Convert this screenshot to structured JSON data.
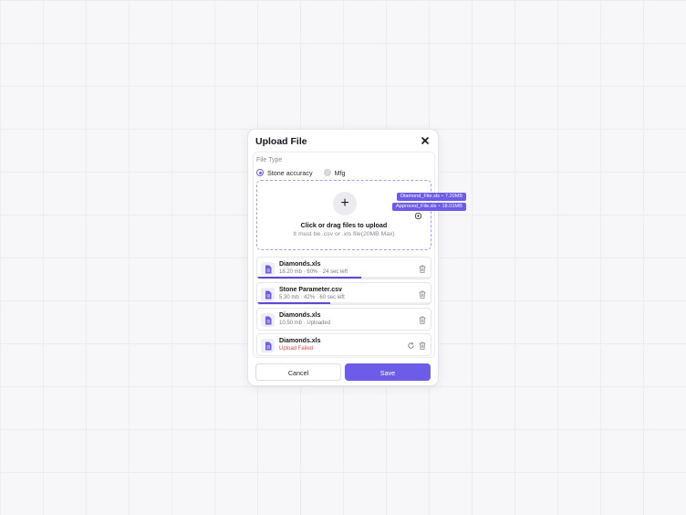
{
  "dialog": {
    "title": "Upload File",
    "file_type_label": "File Type",
    "options": [
      {
        "label": "Stone accuracy",
        "selected": true
      },
      {
        "label": "Mfg",
        "selected": false
      }
    ]
  },
  "dropzone": {
    "title": "Click or drag files to upload",
    "hint": "It must be .csv or .xls file(20MB Max)"
  },
  "dragging": [
    {
      "name": "Diamond_File.xls",
      "size": "7.20MB"
    },
    {
      "name": "Approved_File.xls",
      "size": "18.01MB"
    }
  ],
  "files": [
    {
      "name": "Diamonds.xls",
      "size": "18.20 mb",
      "progress_pct": 60,
      "progress": "60%",
      "time_left": "24 sec left",
      "status": "uploading"
    },
    {
      "name": "Stone Parameter.csv",
      "size": "5.30 mb",
      "progress_pct": 42,
      "progress": "42%",
      "time_left": "60 sec left",
      "status": "uploading"
    },
    {
      "name": "Diamonds.xls",
      "size": "10.50 mb",
      "status_text": "Uploaded",
      "status": "uploaded"
    },
    {
      "name": "Diamonds.xls",
      "status_text": "Upload Failed",
      "status": "failed"
    }
  ],
  "actions": {
    "cancel": "Cancel",
    "save": "Save"
  },
  "colors": {
    "accent": "#6c5ce7",
    "error": "#e5484d"
  },
  "icons": {
    "close": "close-icon",
    "add": "plus-icon",
    "file": "file-icon",
    "delete": "trash-icon",
    "retry": "retry-icon"
  }
}
